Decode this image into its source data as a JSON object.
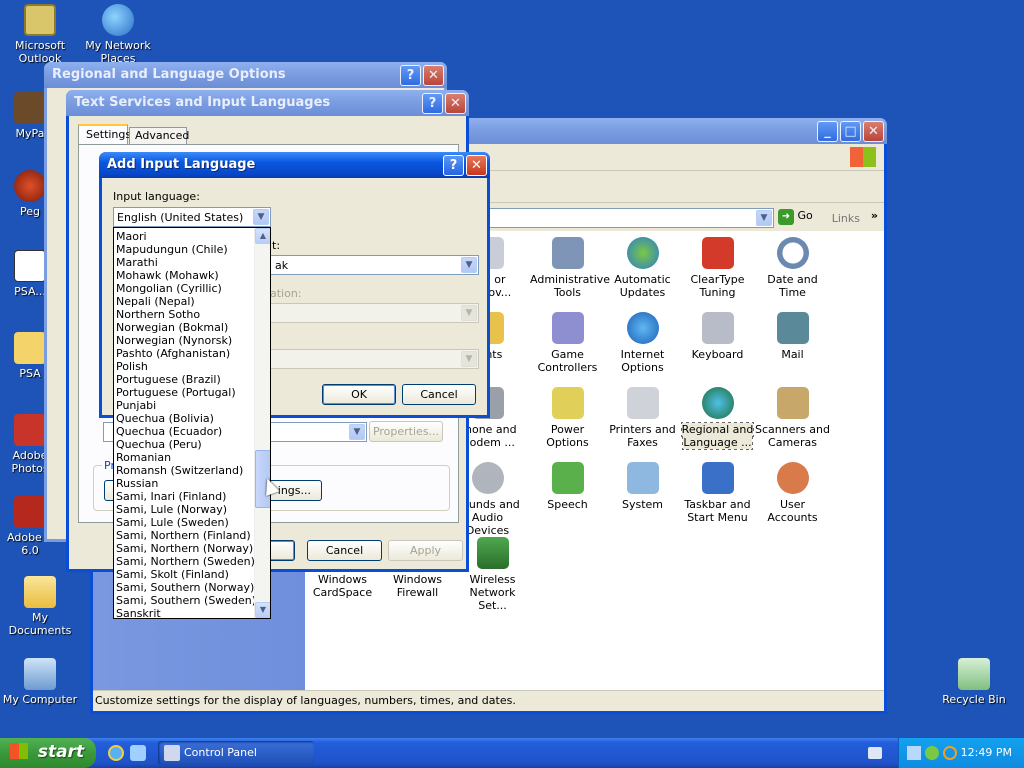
{
  "desktop": {
    "icons": [
      {
        "label": "Microsoft Outlook"
      },
      {
        "label": "My Network Places"
      },
      {
        "label": "MyPa"
      },
      {
        "label": "Peg"
      },
      {
        "label": "PSA..."
      },
      {
        "label": "PSA"
      },
      {
        "label": "Adobe Photos"
      },
      {
        "label": "Adobe R 6.0"
      },
      {
        "label": "My Documents"
      },
      {
        "label": "My Computer"
      },
      {
        "label": "Recycle Bin"
      }
    ]
  },
  "control_panel": {
    "go_label": "Go",
    "links_label": "Links",
    "links_chevron": "»",
    "status_text": "Customize settings for the display of languages, numbers, times, and dates.",
    "icons": [
      {
        "label": "Add or Remov..."
      },
      {
        "label": "Administrative Tools"
      },
      {
        "label": "Automatic Updates"
      },
      {
        "label": "ClearType Tuning"
      },
      {
        "label": "Date and Time"
      },
      {
        "label": "Fonts"
      },
      {
        "label": "Game Controllers"
      },
      {
        "label": "Internet Options"
      },
      {
        "label": "Keyboard"
      },
      {
        "label": "Mail"
      },
      {
        "label": "Phone and Modem ..."
      },
      {
        "label": "Power Options"
      },
      {
        "label": "Printers and Faxes"
      },
      {
        "label": "Regional and Language ..."
      },
      {
        "label": "Scanners and Cameras"
      },
      {
        "label": "Sounds and Audio Devices"
      },
      {
        "label": "Speech"
      },
      {
        "label": "System"
      },
      {
        "label": "Taskbar and Start Menu"
      },
      {
        "label": "User Accounts"
      },
      {
        "label": "Windows CardSpace"
      },
      {
        "label": "Windows Firewall"
      },
      {
        "label": "Wireless Network Set..."
      }
    ]
  },
  "regional_window": {
    "title": "Regional and Language Options",
    "help": "?",
    "close": "✕"
  },
  "text_services": {
    "title": "Text Services and Input Languages",
    "help": "?",
    "close": "✕",
    "tabs": [
      "Settings",
      "Advanced"
    ],
    "properties_label": "Properties...",
    "pre_label": "Pre",
    "key_settings_label": "ings...",
    "ok_label": "OK",
    "cancel_label": "Cancel",
    "apply_label": "Apply"
  },
  "add_input": {
    "title": "Add Input Language",
    "help": "?",
    "close": "✕",
    "input_language_label": "Input language:",
    "selected_language": "English (United States)",
    "second_label_fragment": "t:",
    "second_value_fragment": "ak",
    "third_label_fragment": "ation:",
    "ok_label": "OK",
    "cancel_label": "Cancel",
    "languages": [
      "Maori",
      "Mapudungun (Chile)",
      "Marathi",
      "Mohawk (Mohawk)",
      "Mongolian (Cyrillic)",
      "Nepali (Nepal)",
      "Northern Sotho",
      "Norwegian (Bokmal)",
      "Norwegian (Nynorsk)",
      "Pashto (Afghanistan)",
      "Polish",
      "Portuguese (Brazil)",
      "Portuguese (Portugal)",
      "Punjabi",
      "Quechua (Bolivia)",
      "Quechua (Ecuador)",
      "Quechua (Peru)",
      "Romanian",
      "Romansh (Switzerland)",
      "Russian",
      "Sami, Inari (Finland)",
      "Sami, Lule (Norway)",
      "Sami, Lule (Sweden)",
      "Sami, Northern (Finland)",
      "Sami, Northern (Norway)",
      "Sami, Northern (Sweden)",
      "Sami, Skolt (Finland)",
      "Sami, Southern (Norway)",
      "Sami, Southern (Sweden)",
      "Sanskrit"
    ]
  },
  "taskbar": {
    "start_label": "start",
    "task_label": "Control Panel",
    "clock": "12:49 PM"
  }
}
